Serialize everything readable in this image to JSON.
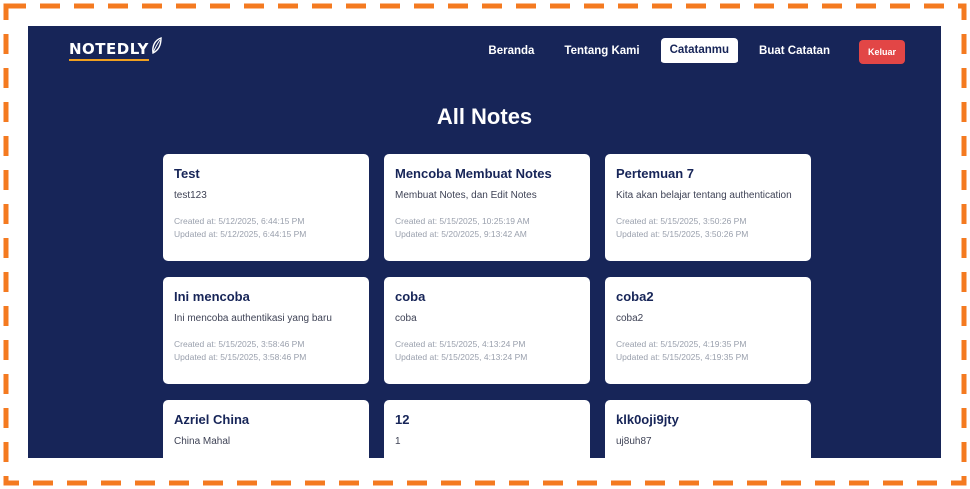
{
  "brand": {
    "logo_text": "NOTEDLY"
  },
  "nav": {
    "items": [
      {
        "label": "Beranda",
        "active": false
      },
      {
        "label": "Tentang Kami",
        "active": false
      },
      {
        "label": "Catatanmu",
        "active": true
      },
      {
        "label": "Buat Catatan",
        "active": false
      }
    ],
    "logout_label": "Keluar"
  },
  "page": {
    "title": "All Notes"
  },
  "notes": [
    {
      "title": "Test",
      "body": "test123",
      "created": "Created at: 5/12/2025, 6:44:15 PM",
      "updated": "Updated at: 5/12/2025, 6:44:15 PM"
    },
    {
      "title": "Mencoba Membuat Notes",
      "body": "Membuat Notes, dan Edit Notes",
      "created": "Created at: 5/15/2025, 10:25:19 AM",
      "updated": "Updated at: 5/20/2025, 9:13:42 AM"
    },
    {
      "title": "Pertemuan 7",
      "body": "Kita akan belajar tentang authentication",
      "created": "Created at: 5/15/2025, 3:50:26 PM",
      "updated": "Updated at: 5/15/2025, 3:50:26 PM"
    },
    {
      "title": "Ini mencoba",
      "body": "Ini mencoba authentikasi yang baru",
      "created": "Created at: 5/15/2025, 3:58:46 PM",
      "updated": "Updated at: 5/15/2025, 3:58:46 PM"
    },
    {
      "title": "coba",
      "body": "coba",
      "created": "Created at: 5/15/2025, 4:13:24 PM",
      "updated": "Updated at: 5/15/2025, 4:13:24 PM"
    },
    {
      "title": "coba2",
      "body": "coba2",
      "created": "Created at: 5/15/2025, 4:19:35 PM",
      "updated": "Updated at: 5/15/2025, 4:19:35 PM"
    },
    {
      "title": "Azriel China",
      "body": "China Mahal",
      "created": "",
      "updated": ""
    },
    {
      "title": "12",
      "body": "1",
      "created": "",
      "updated": ""
    },
    {
      "title": "klk0oji9jty",
      "body": "uj8uh87",
      "created": "",
      "updated": ""
    }
  ],
  "colors": {
    "background": "#172558",
    "accent": "#f0a020",
    "logout": "#e24646",
    "frame": "#f47a20"
  },
  "icons": {
    "logo_mark": "leaf-icon"
  }
}
